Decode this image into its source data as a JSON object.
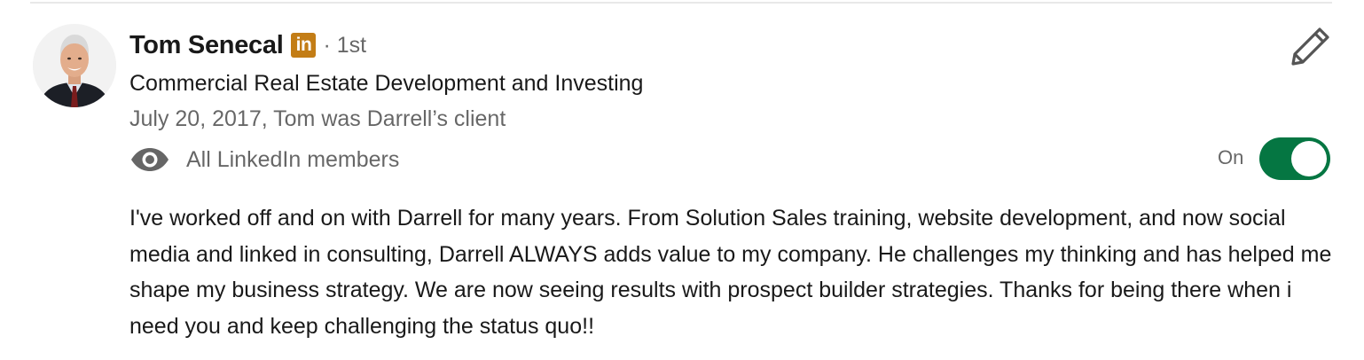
{
  "recommendation": {
    "name": "Tom Senecal",
    "badge": "in",
    "degree": "· 1st",
    "headline": "Commercial Real Estate Development and Investing",
    "meta": "July 20, 2017, Tom was Darrell’s client",
    "visibility": {
      "icon": "eye-icon",
      "label": "All LinkedIn members"
    },
    "toggle": {
      "label": "On",
      "state": "on",
      "color": "#057642"
    },
    "edit_icon": "pencil-icon",
    "text": "I've worked off and on with Darrell for many years. From Solution Sales training, website development, and now social media and linked in consulting, Darrell ALWAYS adds value to my company. He challenges my thinking and has helped me shape my business strategy. We are now seeing results with prospect builder strategies. Thanks for being there when i need you and keep challenging the status quo!!"
  },
  "colors": {
    "badge": "#c37d16",
    "toggle_on": "#057642",
    "secondary_text": "#666666"
  }
}
